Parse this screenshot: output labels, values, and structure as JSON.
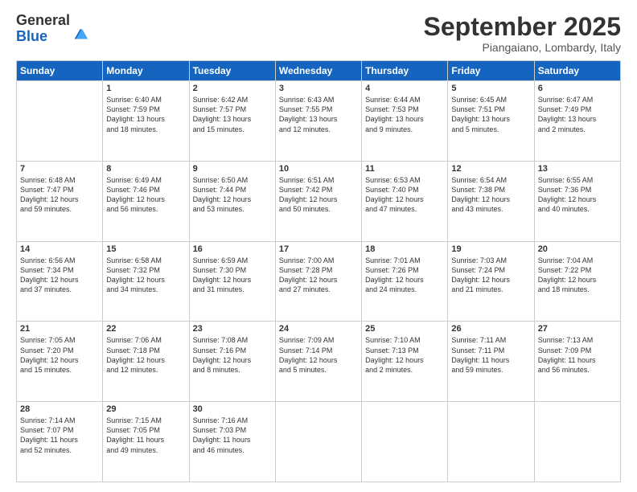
{
  "logo": {
    "general": "General",
    "blue": "Blue"
  },
  "title": "September 2025",
  "location": "Piangaiano, Lombardy, Italy",
  "weekdays": [
    "Sunday",
    "Monday",
    "Tuesday",
    "Wednesday",
    "Thursday",
    "Friday",
    "Saturday"
  ],
  "weeks": [
    [
      {
        "day": "",
        "info": ""
      },
      {
        "day": "1",
        "info": "Sunrise: 6:40 AM\nSunset: 7:59 PM\nDaylight: 13 hours\nand 18 minutes."
      },
      {
        "day": "2",
        "info": "Sunrise: 6:42 AM\nSunset: 7:57 PM\nDaylight: 13 hours\nand 15 minutes."
      },
      {
        "day": "3",
        "info": "Sunrise: 6:43 AM\nSunset: 7:55 PM\nDaylight: 13 hours\nand 12 minutes."
      },
      {
        "day": "4",
        "info": "Sunrise: 6:44 AM\nSunset: 7:53 PM\nDaylight: 13 hours\nand 9 minutes."
      },
      {
        "day": "5",
        "info": "Sunrise: 6:45 AM\nSunset: 7:51 PM\nDaylight: 13 hours\nand 5 minutes."
      },
      {
        "day": "6",
        "info": "Sunrise: 6:47 AM\nSunset: 7:49 PM\nDaylight: 13 hours\nand 2 minutes."
      }
    ],
    [
      {
        "day": "7",
        "info": "Sunrise: 6:48 AM\nSunset: 7:47 PM\nDaylight: 12 hours\nand 59 minutes."
      },
      {
        "day": "8",
        "info": "Sunrise: 6:49 AM\nSunset: 7:46 PM\nDaylight: 12 hours\nand 56 minutes."
      },
      {
        "day": "9",
        "info": "Sunrise: 6:50 AM\nSunset: 7:44 PM\nDaylight: 12 hours\nand 53 minutes."
      },
      {
        "day": "10",
        "info": "Sunrise: 6:51 AM\nSunset: 7:42 PM\nDaylight: 12 hours\nand 50 minutes."
      },
      {
        "day": "11",
        "info": "Sunrise: 6:53 AM\nSunset: 7:40 PM\nDaylight: 12 hours\nand 47 minutes."
      },
      {
        "day": "12",
        "info": "Sunrise: 6:54 AM\nSunset: 7:38 PM\nDaylight: 12 hours\nand 43 minutes."
      },
      {
        "day": "13",
        "info": "Sunrise: 6:55 AM\nSunset: 7:36 PM\nDaylight: 12 hours\nand 40 minutes."
      }
    ],
    [
      {
        "day": "14",
        "info": "Sunrise: 6:56 AM\nSunset: 7:34 PM\nDaylight: 12 hours\nand 37 minutes."
      },
      {
        "day": "15",
        "info": "Sunrise: 6:58 AM\nSunset: 7:32 PM\nDaylight: 12 hours\nand 34 minutes."
      },
      {
        "day": "16",
        "info": "Sunrise: 6:59 AM\nSunset: 7:30 PM\nDaylight: 12 hours\nand 31 minutes."
      },
      {
        "day": "17",
        "info": "Sunrise: 7:00 AM\nSunset: 7:28 PM\nDaylight: 12 hours\nand 27 minutes."
      },
      {
        "day": "18",
        "info": "Sunrise: 7:01 AM\nSunset: 7:26 PM\nDaylight: 12 hours\nand 24 minutes."
      },
      {
        "day": "19",
        "info": "Sunrise: 7:03 AM\nSunset: 7:24 PM\nDaylight: 12 hours\nand 21 minutes."
      },
      {
        "day": "20",
        "info": "Sunrise: 7:04 AM\nSunset: 7:22 PM\nDaylight: 12 hours\nand 18 minutes."
      }
    ],
    [
      {
        "day": "21",
        "info": "Sunrise: 7:05 AM\nSunset: 7:20 PM\nDaylight: 12 hours\nand 15 minutes."
      },
      {
        "day": "22",
        "info": "Sunrise: 7:06 AM\nSunset: 7:18 PM\nDaylight: 12 hours\nand 12 minutes."
      },
      {
        "day": "23",
        "info": "Sunrise: 7:08 AM\nSunset: 7:16 PM\nDaylight: 12 hours\nand 8 minutes."
      },
      {
        "day": "24",
        "info": "Sunrise: 7:09 AM\nSunset: 7:14 PM\nDaylight: 12 hours\nand 5 minutes."
      },
      {
        "day": "25",
        "info": "Sunrise: 7:10 AM\nSunset: 7:13 PM\nDaylight: 12 hours\nand 2 minutes."
      },
      {
        "day": "26",
        "info": "Sunrise: 7:11 AM\nSunset: 7:11 PM\nDaylight: 11 hours\nand 59 minutes."
      },
      {
        "day": "27",
        "info": "Sunrise: 7:13 AM\nSunset: 7:09 PM\nDaylight: 11 hours\nand 56 minutes."
      }
    ],
    [
      {
        "day": "28",
        "info": "Sunrise: 7:14 AM\nSunset: 7:07 PM\nDaylight: 11 hours\nand 52 minutes."
      },
      {
        "day": "29",
        "info": "Sunrise: 7:15 AM\nSunset: 7:05 PM\nDaylight: 11 hours\nand 49 minutes."
      },
      {
        "day": "30",
        "info": "Sunrise: 7:16 AM\nSunset: 7:03 PM\nDaylight: 11 hours\nand 46 minutes."
      },
      {
        "day": "",
        "info": ""
      },
      {
        "day": "",
        "info": ""
      },
      {
        "day": "",
        "info": ""
      },
      {
        "day": "",
        "info": ""
      }
    ]
  ]
}
